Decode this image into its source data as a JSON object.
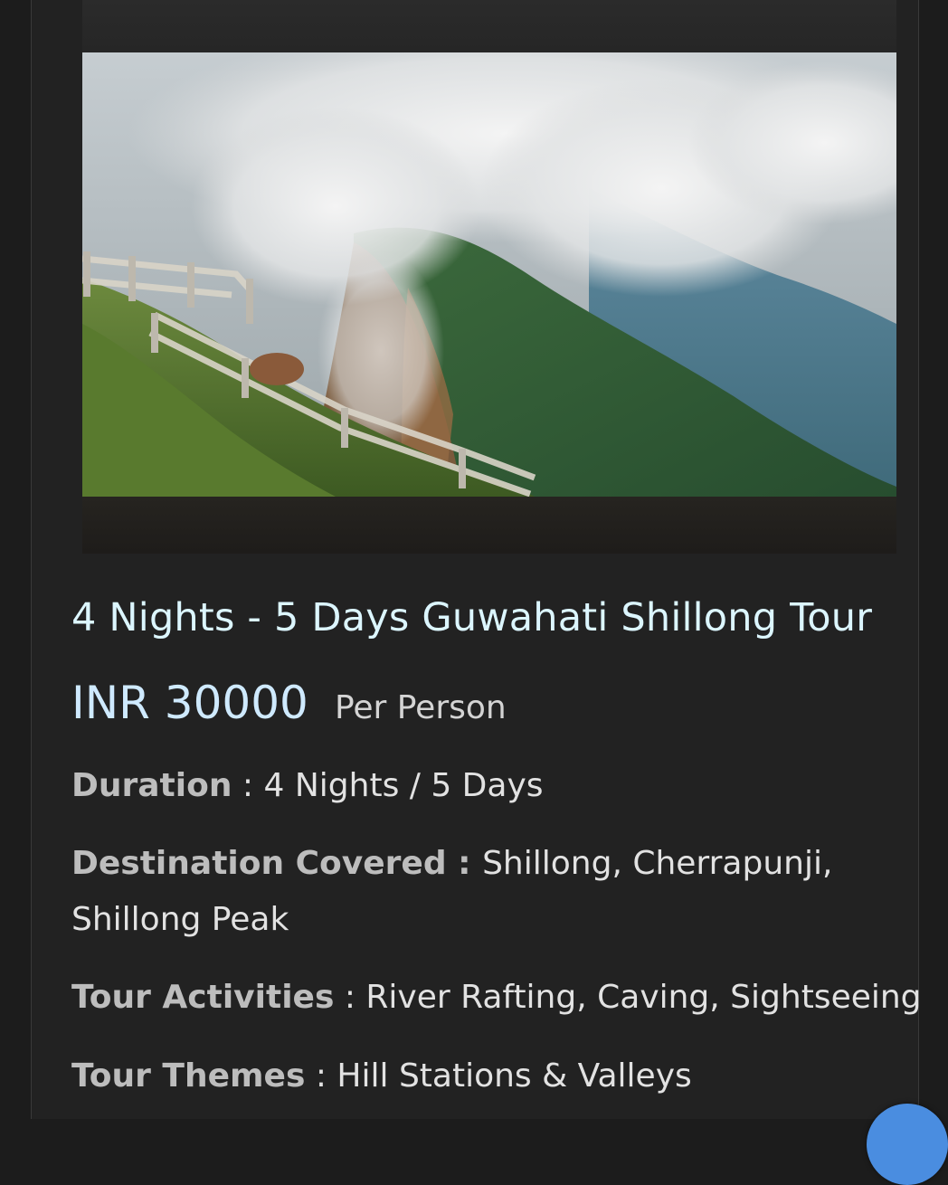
{
  "tour": {
    "title": "4 Nights - 5 Days Guwahati Shillong Tour",
    "price": "INR 30000",
    "price_unit": "Per Person",
    "duration_label": "Duration",
    "duration_value": "4 Nights / 5 Days",
    "destination_label": "Destination Covered :",
    "destination_value": "Shillong, Cherrapunji, Shillong Peak",
    "activities_label": "Tour Activities",
    "activities_value": "River Rafting, Caving, Sightseeing",
    "themes_label": "Tour Themes",
    "themes_value": "Hill Stations & Valleys"
  },
  "colors": {
    "title": "#dcf6ff",
    "price": "#cfeaff",
    "label": "#bdbdbd",
    "background": "#222222",
    "fab": "#4a8de0"
  },
  "icons": {
    "fab": "chat-bubble-icon"
  }
}
